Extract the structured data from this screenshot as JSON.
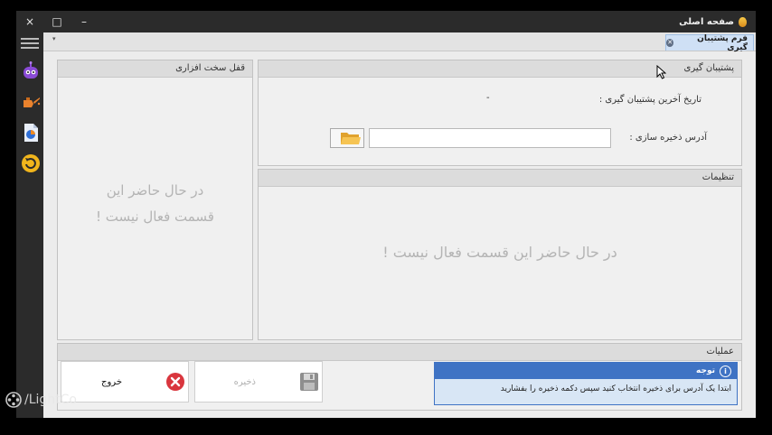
{
  "window": {
    "title": "صفحه اصلی",
    "close_glyph": "×",
    "maximize_glyph": "□",
    "minimize_glyph": "–"
  },
  "sidebar": {
    "items": [
      {
        "icon": "robot-icon"
      },
      {
        "icon": "oil-can-icon"
      },
      {
        "icon": "chart-document-icon"
      },
      {
        "icon": "refresh-circle-icon"
      }
    ]
  },
  "tabs": [
    {
      "label": "فرم پشتیبان گیری",
      "active": true
    }
  ],
  "tab_dropdown_glyph": "▾",
  "hardware_lock": {
    "title": "قفل سخت افزاری",
    "message_line1": "در حال حاضر این",
    "message_line2": "قسمت فعال نیست !"
  },
  "backup": {
    "title": "پشتیبان گیری",
    "last_backup_label": "تاریخ آخرین پشتیبان گیری :",
    "last_backup_value": "-",
    "save_path_label": "آدرس ذخیره سازی :",
    "save_path_value": ""
  },
  "settings": {
    "title": "تنظیمات",
    "message": "در حال حاضر این قسمت فعال نیست !"
  },
  "operations": {
    "title": "عملیات",
    "exit_label": "خروج",
    "save_label": "ذخیره"
  },
  "notice": {
    "title": "توجه",
    "message": "ابتدا یک آدرس برای ذخیره انتخاب کنید سپس دکمه ذخیره را بفشارید"
  },
  "watermark": {
    "text": "/LightCo"
  },
  "colors": {
    "accent": "#3f73c4",
    "tab_active": "#cfe0f5",
    "inactive_text": "#b4b4b4",
    "exit_red": "#d9363e"
  }
}
